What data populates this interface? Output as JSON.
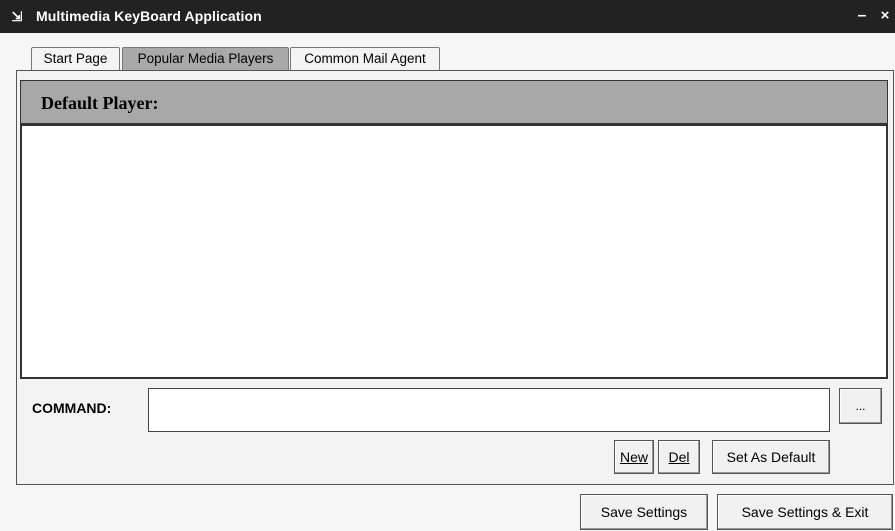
{
  "window": {
    "title": "Multimedia KeyBoard Application",
    "icon": "app-icon",
    "minimize_label": "–",
    "close_label": "×"
  },
  "tabs": [
    {
      "label": "Start Page",
      "selected": false
    },
    {
      "label": "Popular Media Players",
      "selected": true
    },
    {
      "label": "Common Mail Agent",
      "selected": false
    }
  ],
  "panel": {
    "header": "Default Player:",
    "player_list_items": []
  },
  "command": {
    "label": "COMMAND:",
    "value": "",
    "browse_label": "..."
  },
  "buttons": {
    "new": "New",
    "del": "Del",
    "set_default": "Set As Default",
    "save": "Save Settings",
    "save_exit": "Save Settings & Exit"
  },
  "colors": {
    "titlebar": "#222222",
    "selected_tab": "#a9a9a9",
    "panel_header": "#a8a8a8"
  }
}
